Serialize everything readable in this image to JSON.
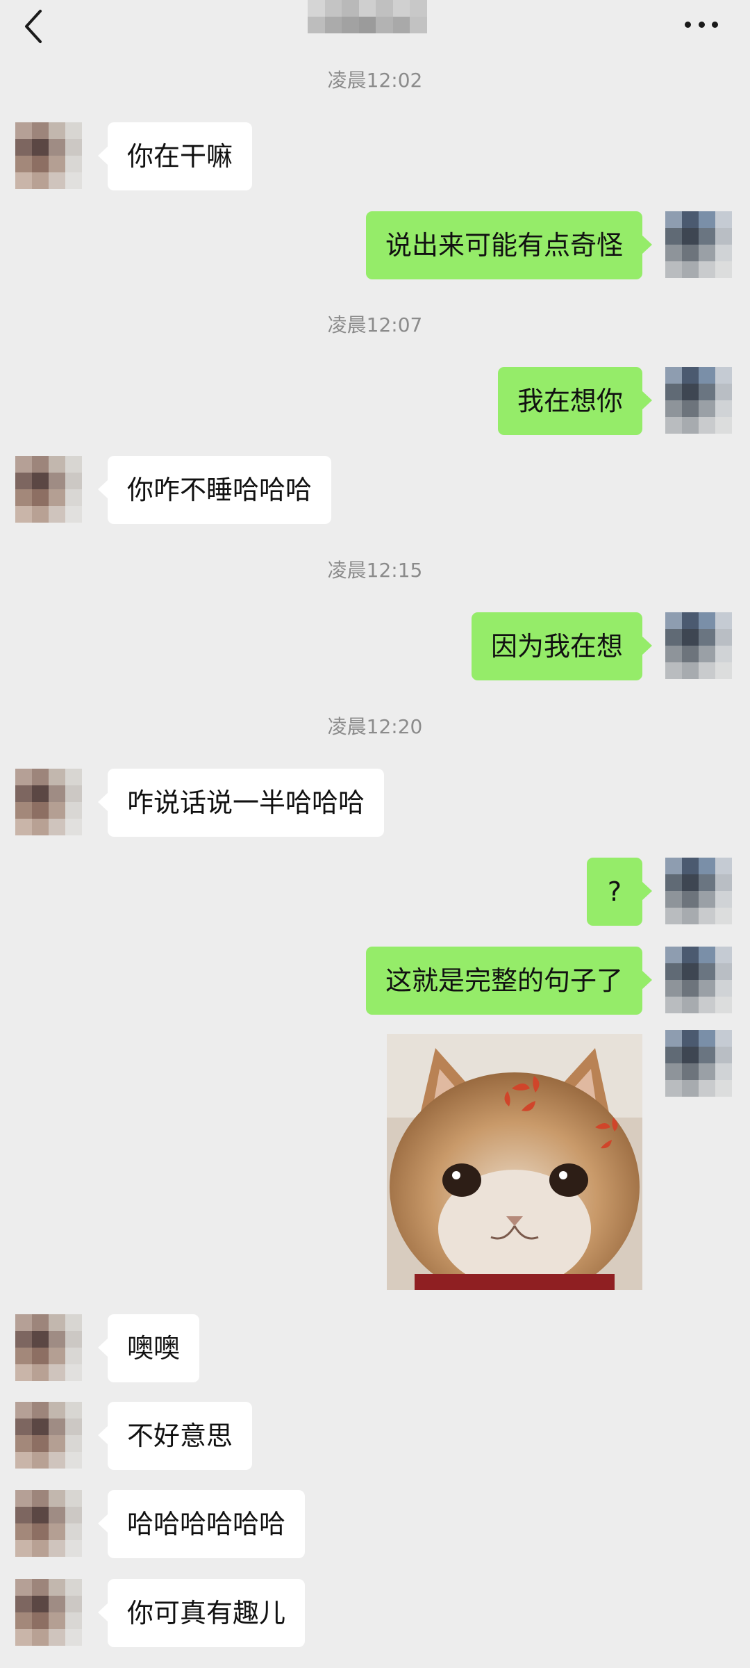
{
  "header": {
    "back": "back-icon",
    "more": "more-icon",
    "title_obscured": true
  },
  "colors": {
    "background": "#ededed",
    "incoming_bubble": "#ffffff",
    "outgoing_bubble": "#95ec69",
    "timestamp": "#8b8b8b"
  },
  "timestamps": [
    "凌晨12:02",
    "凌晨12:07",
    "凌晨12:15",
    "凌晨12:20"
  ],
  "messages": [
    {
      "side": "in",
      "text": "你在干嘛"
    },
    {
      "side": "out",
      "text": "说出来可能有点奇怪"
    },
    {
      "side": "out",
      "text": "我在想你"
    },
    {
      "side": "in",
      "text": "你咋不睡哈哈哈"
    },
    {
      "side": "out",
      "text": "因为我在想"
    },
    {
      "side": "in",
      "text": "咋说话说一半哈哈哈"
    },
    {
      "side": "out",
      "text": "?"
    },
    {
      "side": "out",
      "text": "这就是完整的句子了"
    },
    {
      "side": "out",
      "type": "sticker",
      "sticker": "angry-cat-sticker"
    },
    {
      "side": "in",
      "text": "噢噢"
    },
    {
      "side": "in",
      "text": "不好意思"
    },
    {
      "side": "in",
      "text": "哈哈哈哈哈哈"
    },
    {
      "side": "in",
      "text": "你可真有趣儿"
    }
  ]
}
